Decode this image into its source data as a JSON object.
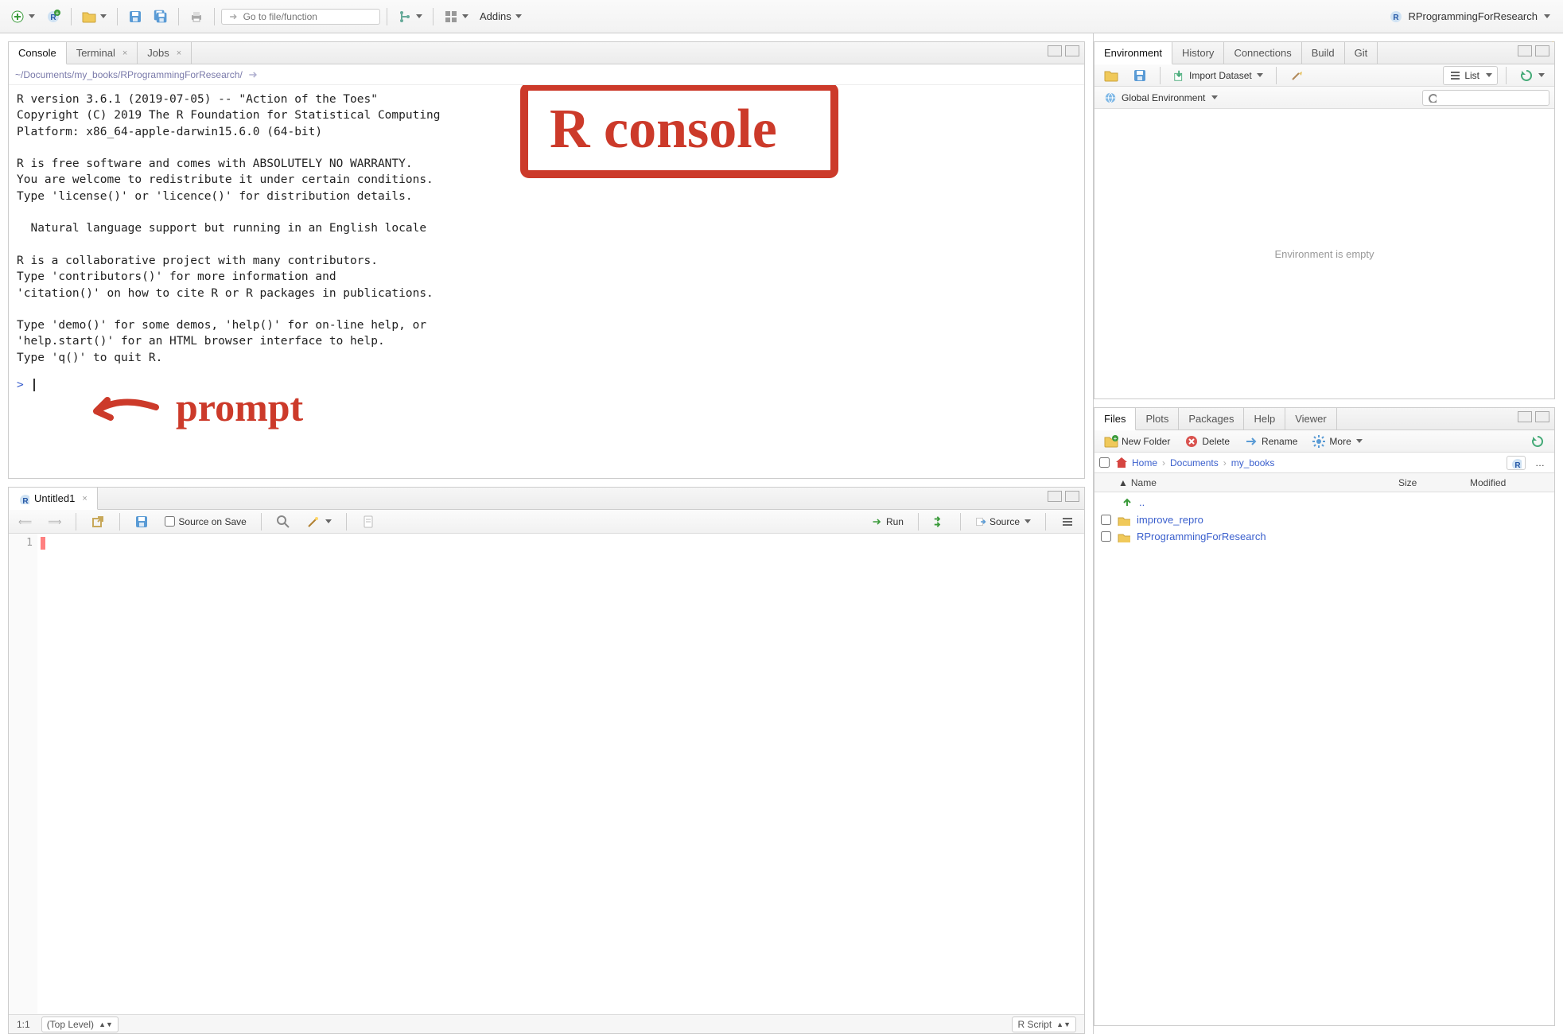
{
  "toolbar": {
    "goto_placeholder": "Go to file/function",
    "addins_label": "Addins"
  },
  "project": {
    "name": "RProgrammingForResearch"
  },
  "console": {
    "tabs": [
      "Console",
      "Terminal",
      "Jobs"
    ],
    "active": 0,
    "path": "~/Documents/my_books/RProgrammingForResearch/",
    "text": "R version 3.6.1 (2019-07-05) -- \"Action of the Toes\"\nCopyright (C) 2019 The R Foundation for Statistical Computing\nPlatform: x86_64-apple-darwin15.6.0 (64-bit)\n\nR is free software and comes with ABSOLUTELY NO WARRANTY.\nYou are welcome to redistribute it under certain conditions.\nType 'license()' or 'licence()' for distribution details.\n\n  Natural language support but running in an English locale\n\nR is a collaborative project with many contributors.\nType 'contributors()' for more information and\n'citation()' on how to cite R or R packages in publications.\n\nType 'demo()' for some demos, 'help()' for on-line help, or\n'help.start()' for an HTML browser interface to help.\nType 'q()' to quit R.",
    "prompt": ">"
  },
  "annotations": {
    "title": "R console",
    "prompt": "prompt"
  },
  "source": {
    "tab_label": "Untitled1",
    "source_on_save": "Source on Save",
    "run": "Run",
    "source_btn": "Source",
    "cursor_pos": "1:1",
    "scope": "(Top Level)",
    "lang": "R Script"
  },
  "env": {
    "tabs": [
      "Environment",
      "History",
      "Connections",
      "Build",
      "Git"
    ],
    "active": 0,
    "import": "Import Dataset",
    "list": "List",
    "scope": "Global Environment",
    "empty": "Environment is empty"
  },
  "files": {
    "tabs": [
      "Files",
      "Plots",
      "Packages",
      "Help",
      "Viewer"
    ],
    "active": 0,
    "new_folder": "New Folder",
    "delete": "Delete",
    "rename": "Rename",
    "more": "More",
    "breadcrumb": [
      "Home",
      "Documents",
      "my_books"
    ],
    "cols": {
      "name": "Name",
      "size": "Size",
      "modified": "Modified"
    },
    "up": "..",
    "rows_text": [
      "improve_repro",
      "RProgrammingForResearch"
    ]
  }
}
